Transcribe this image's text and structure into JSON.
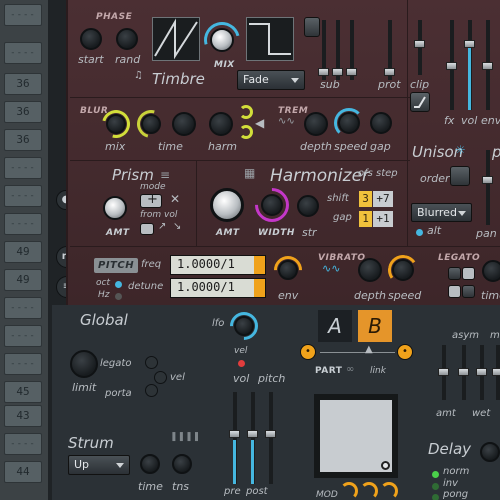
{
  "strip_rows": [
    "----",
    "36",
    "36",
    "36",
    "----",
    "----",
    "----",
    "----",
    "----",
    "49",
    "----",
    "----",
    "----",
    "45",
    "43",
    "----",
    "44"
  ],
  "phase": {
    "header": "PHASE",
    "start": "start",
    "rand": "rand"
  },
  "timbre": {
    "title": "Timbre",
    "mix": "MIX",
    "mode": "Fade"
  },
  "top_faders": {
    "sub": "sub",
    "prot": "prot",
    "clip": "clip",
    "fx": "fx",
    "vol": "vol",
    "env": "env"
  },
  "blur": {
    "header": "BLUR",
    "mix": "mix",
    "time": "time",
    "harm": "harm"
  },
  "trem": {
    "header": "TREM",
    "depth": "depth",
    "speed": "speed",
    "gap": "gap"
  },
  "unison": {
    "title": "Unison",
    "order": "order",
    "mode": "Blurred",
    "alt": "alt",
    "pan": "pan",
    "extra": "p"
  },
  "prism": {
    "title": "Prism",
    "mode": "mode",
    "from_vol": "from vol",
    "amt": "AMT"
  },
  "harmonizer": {
    "title": "Harmonizer",
    "amt": "AMT",
    "width": "WIDTH",
    "str": "str",
    "ofs_step": "ofs step",
    "shift": "shift",
    "gap": "gap",
    "shift_ofs": "3",
    "shift_step": "+7",
    "gap_ofs": "1",
    "gap_step": "+1"
  },
  "pitch": {
    "header": "PITCH",
    "freq": "freq",
    "detune": "detune",
    "oct": "oct",
    "hz": "Hz",
    "freq_value": "1.0000/1",
    "detune_value": "1.0000/1",
    "env": "env"
  },
  "vibrato": {
    "header": "VIBRATO",
    "depth": "depth",
    "speed": "speed"
  },
  "legato": {
    "header": "LEGATO",
    "time": "time"
  },
  "global": {
    "title": "Global",
    "limit": "limit",
    "legato": "legato",
    "porta": "porta",
    "vel": "vel",
    "lfo": "lfo",
    "vel2": "vel",
    "vol": "vol",
    "pitch": "pitch",
    "pre": "pre",
    "post": "post"
  },
  "part": {
    "a": "A",
    "b": "B",
    "label": "PART",
    "link": "link"
  },
  "strum": {
    "title": "Strum",
    "mode": "Up",
    "time": "time",
    "tns": "tns"
  },
  "right_bottom": {
    "asym": "asym",
    "amt": "amt",
    "wet": "wet",
    "m": "m"
  },
  "delay": {
    "title": "Delay",
    "norm": "norm",
    "inv": "inv",
    "pong": "pong"
  },
  "mod_label": "MOD",
  "colors": {
    "accent_orange": "#f0a21b",
    "accent_blue": "#45b7e0",
    "panel_maroon": "#4b2f33"
  },
  "icons": [
    "letter-m-icon",
    "menu-icon",
    "settings-icon",
    "chevron-down-icon"
  ]
}
